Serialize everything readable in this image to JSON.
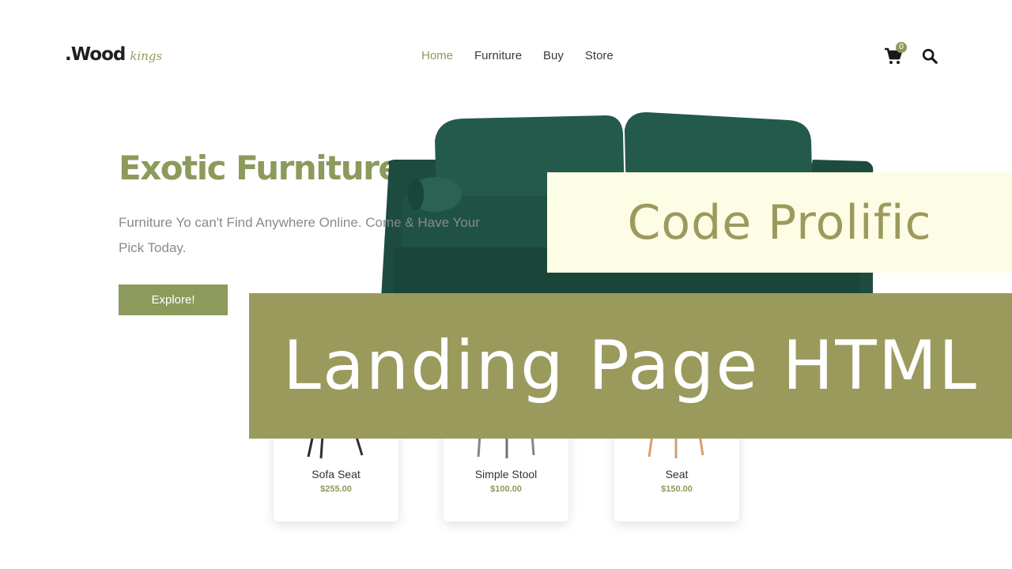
{
  "brand": {
    "name": ".Wood",
    "tagline": "kings"
  },
  "nav": {
    "items": [
      {
        "label": "Home",
        "active": true
      },
      {
        "label": "Furniture",
        "active": false
      },
      {
        "label": "Buy",
        "active": false
      },
      {
        "label": "Store",
        "active": false
      }
    ]
  },
  "header": {
    "cart_icon": "cart-icon",
    "cart_count": "0",
    "search_icon": "search-icon"
  },
  "hero": {
    "title": "Exotic Furniture.",
    "description": "Furniture Yo can't Find Anywhere Online. Come & Have Your Pick Today.",
    "button_label": "Explore!"
  },
  "products": [
    {
      "name": "Sofa Seat",
      "price": "$255.00",
      "leg_color": "#3a2a3a"
    },
    {
      "name": "Simple Stool",
      "price": "$100.00",
      "leg_color": "#7d8a8a"
    },
    {
      "name": "Seat",
      "price": "$150.00",
      "leg_color": "#d9a06a"
    }
  ],
  "overlay": {
    "title": "Code Prolific",
    "subtitle": "Landing Page HTML"
  },
  "colors": {
    "accent": "#8c9a5b",
    "overlay_dark": "#9b9a5d",
    "overlay_light": "#fdfde6",
    "sofa": "#1f5245"
  }
}
